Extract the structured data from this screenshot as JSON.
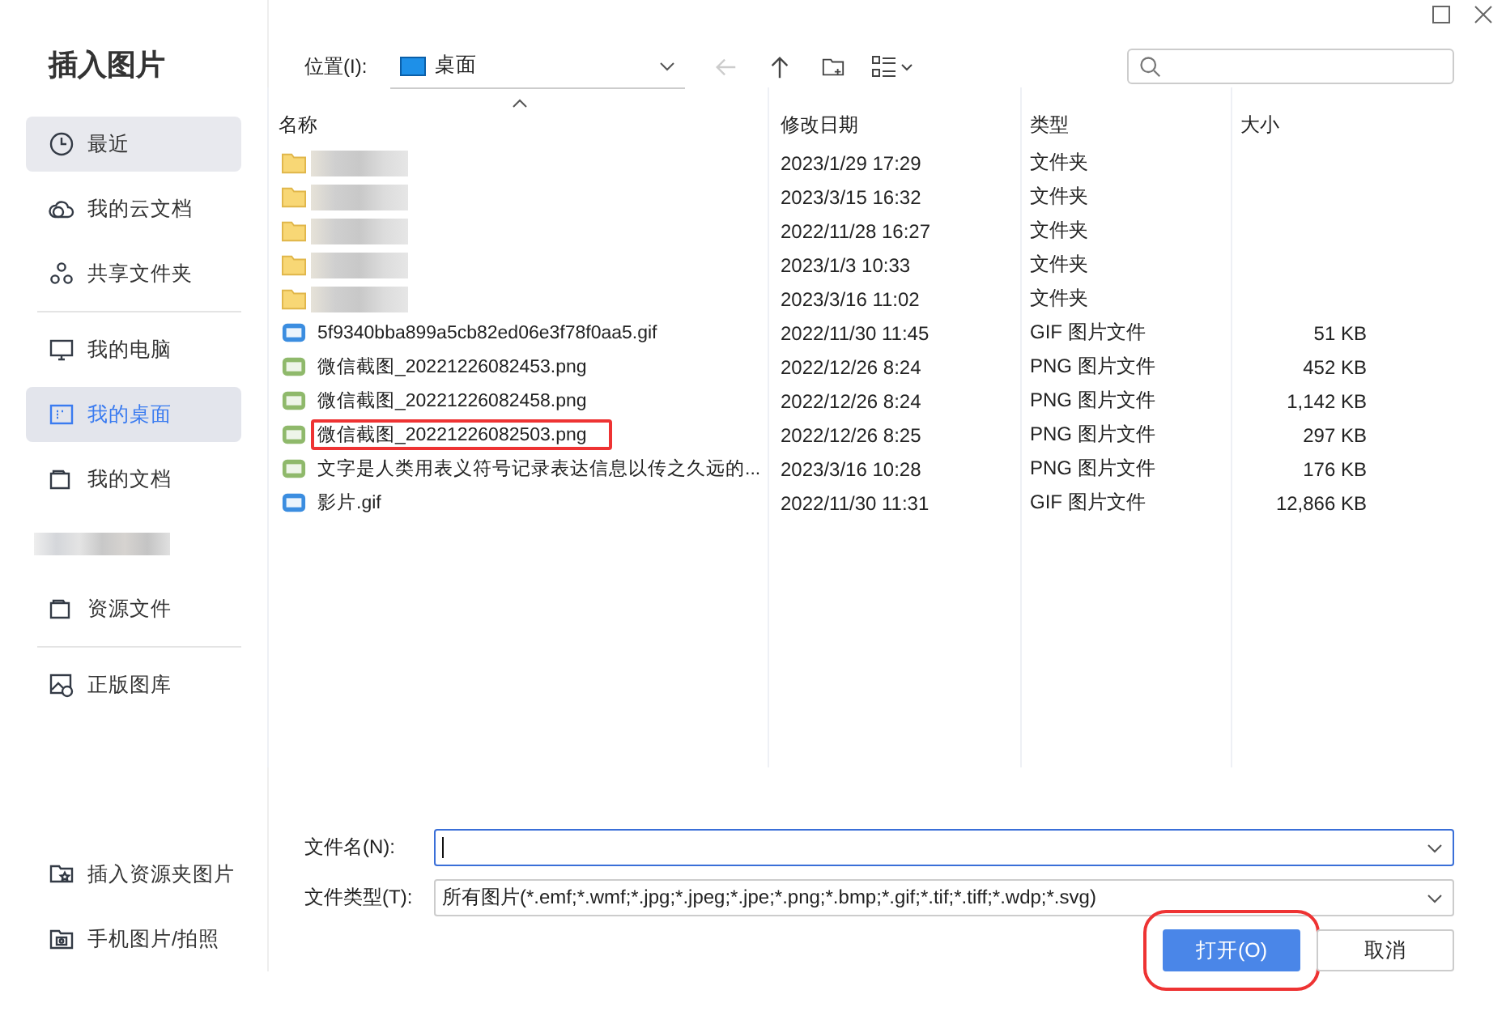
{
  "window": {
    "title": "插入图片"
  },
  "sidebar": {
    "groups": [
      [
        {
          "label": "最近",
          "selected": false,
          "hovered": true
        },
        {
          "label": "我的云文档",
          "selected": false,
          "hovered": false
        },
        {
          "label": "共享文件夹",
          "selected": false,
          "hovered": false
        }
      ],
      [
        {
          "label": "我的电脑",
          "selected": false,
          "hovered": false
        },
        {
          "label": "我的桌面",
          "selected": true,
          "hovered": false
        },
        {
          "label": "我的文档",
          "selected": false,
          "hovered": false
        },
        {
          "kind": "redacted"
        },
        {
          "label": "资源文件",
          "selected": false,
          "hovered": false
        }
      ],
      [
        {
          "label": "正版图库",
          "selected": false,
          "hovered": false
        }
      ]
    ],
    "bottom_items": [
      {
        "label": "插入资源夹图片"
      },
      {
        "label": "手机图片/拍照"
      }
    ]
  },
  "toolbar": {
    "location_label": "位置(I):",
    "location": "桌面"
  },
  "table": {
    "columns": [
      "名称",
      "修改日期",
      "类型",
      "大小"
    ],
    "rows": [
      {
        "kind": "folder",
        "redacted": true,
        "modified": "2023/1/29 17:29",
        "type": "文件夹",
        "highlighted": false
      },
      {
        "kind": "folder",
        "redacted": true,
        "modified": "2023/3/15 16:32",
        "type": "文件夹",
        "highlighted": false
      },
      {
        "kind": "folder",
        "redacted": true,
        "modified": "2022/11/28 16:27",
        "type": "文件夹",
        "highlighted": false
      },
      {
        "kind": "folder",
        "redacted": true,
        "modified": "2023/1/3 10:33",
        "type": "文件夹",
        "highlighted": false
      },
      {
        "kind": "folder",
        "redacted": true,
        "modified": "2023/3/16 11:02",
        "type": "文件夹",
        "highlighted": false
      },
      {
        "kind": "gif",
        "name": "5f9340bba899a5cb82ed06e3f78f0aa5.gif",
        "modified": "2022/11/30 11:45",
        "type": "GIF 图片文件",
        "size": "51 KB",
        "highlighted": false
      },
      {
        "kind": "png",
        "name": "微信截图_20221226082453.png",
        "modified": "2022/12/26 8:24",
        "type": "PNG 图片文件",
        "size": "452 KB",
        "highlighted": false
      },
      {
        "kind": "png",
        "name": "微信截图_20221226082458.png",
        "modified": "2022/12/26 8:24",
        "type": "PNG 图片文件",
        "size": "1,142 KB",
        "highlighted": false
      },
      {
        "kind": "png",
        "name": "微信截图_20221226082503.png",
        "modified": "2022/12/26 8:25",
        "type": "PNG 图片文件",
        "size": "297 KB",
        "highlighted": true
      },
      {
        "kind": "png",
        "name": "文字是人类用表义符号记录表达信息以传之久远的...",
        "modified": "2023/3/16 10:28",
        "type": "PNG 图片文件",
        "size": "176 KB",
        "highlighted": false
      },
      {
        "kind": "gif",
        "name": "影片.gif",
        "modified": "2022/11/30 11:31",
        "type": "GIF 图片文件",
        "size": "12,866 KB",
        "highlighted": false
      }
    ]
  },
  "footer": {
    "filename_label": "文件名(N):",
    "filetype_label": "文件类型(T):",
    "filetype": "所有图片(*.emf;*.wmf;*.jpg;*.jpeg;*.jpe;*.png;*.bmp;*.gif;*.tif;*.tiff;*.wdp;*.svg)",
    "buttons": [
      {
        "label": "打开(O)",
        "kind": "primary",
        "highlighted": true
      },
      {
        "label": "取消",
        "kind": "secondary",
        "highlighted": false
      }
    ]
  }
}
